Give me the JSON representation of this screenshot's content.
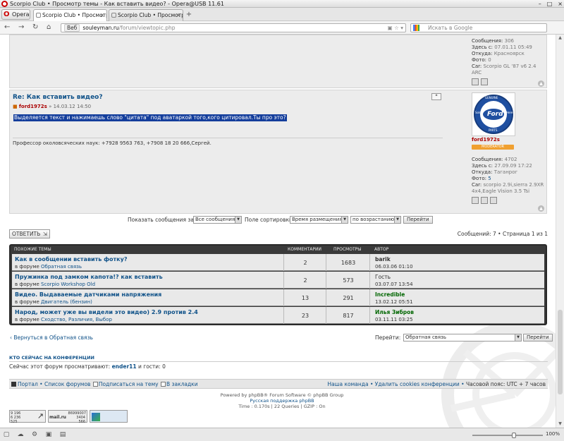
{
  "window": {
    "title": "Scorpio Club • Просмотр темы - Как вставить видео? - Opera@USB 11.61",
    "controls": [
      "–",
      "□",
      "×"
    ]
  },
  "browser": {
    "menu_label": "Opera",
    "tabs": [
      {
        "label": "Scorpio Club • Просмотр...",
        "active": true
      },
      {
        "label": "Scorpio Club • Просмотр...",
        "active": false
      }
    ],
    "badge": "Веб",
    "url_host": "souleyman.ru",
    "url_path": "/forum/viewtopic.php",
    "search_placeholder": "Искать в Google"
  },
  "prev_profile": {
    "messages_label": "Сообщения:",
    "messages": "306",
    "here_label": "Здесь с:",
    "here": "07.01.11 05:49",
    "from_label": "Откуда:",
    "from": "Красноярск",
    "photo_label": "Фото:",
    "photo": "0",
    "car_label": "Car:",
    "car": "Scorpio GL '87 v6 2.4 ARC"
  },
  "post": {
    "title": "Re: Как вставить видео?",
    "author": "ford1972s",
    "date": "» 14.03.12 14:50",
    "selected_text": "Выделяется текст и нажимаешь слово \"цитата\" под аватаркой того,кого цитировал.Ты про это?",
    "signature": "Профессор околовсяческих наук: +7928 9563 763, +7908 18 20 666,Сергей.",
    "quote_btn": "❝"
  },
  "profile": {
    "avatar_genuine": "GENUINE",
    "avatar_brand": "Ford",
    "avatar_parts": "PARTS",
    "avatar_left": "Sold",
    "avatar_right": "Here",
    "username": "ford1972s",
    "rank": "MODERATOR",
    "messages_label": "Сообщения:",
    "messages": "4702",
    "here_label": "Здесь с:",
    "here": "27.09.09 17:22",
    "from_label": "Откуда:",
    "from": "Таганрог",
    "photo_label": "Фото:",
    "photo": "5",
    "car_label": "Car:",
    "car": "scorpio 2.9i,sierra 2.9XR 4x4,Eagle Vision 3.5 Tsi"
  },
  "sortbar": {
    "show_label": "Показать сообщения за:",
    "show_value": "Все сообщения",
    "sort_label": "Поле сортировки",
    "sort_value": "Время размещения",
    "order_value": "по возрастанию",
    "go_label": "Перейти"
  },
  "reply_label": "ОТВЕТИТЬ",
  "page_info": "Сообщений: 7 • Страница 1 из 1",
  "similar": {
    "headers": {
      "topics": "ПОХОЖИЕ ТЕМЫ",
      "comments": "КОММЕНТАРИИ",
      "views": "ПРОСМОТРЫ",
      "author": "АВТОР"
    },
    "rows": [
      {
        "title": "Как в сообщении вставить фотку?",
        "forum_prefix": "в форуме",
        "forum": "Обратная связь",
        "comments": "2",
        "views": "1683",
        "author": "barik",
        "date": "06.03.06 01:10"
      },
      {
        "title": "Пружинка под замком капота!? как вставить",
        "forum_prefix": "в форуме",
        "forum": "Scorpio Workshop Old",
        "comments": "2",
        "views": "573",
        "author": "Гость",
        "date": "03.07.07 13:54"
      },
      {
        "title": "Видео. Выдаваемые датчиками напряжения",
        "forum_prefix": "в форуме",
        "forum": "Двигатель (бензин)",
        "comments": "13",
        "views": "291",
        "author": "Incredible",
        "date": "13.02.12 05:51"
      },
      {
        "title": "Народ, может уже вы видели это видео) 2.9 против 2.4",
        "forum_prefix": "в форуме",
        "forum": "Сходство, Различия, Выбор",
        "comments": "23",
        "views": "817",
        "author": "Илья Зибров",
        "date": "03.11.11 03:25"
      }
    ]
  },
  "back_link": "‹ Вернуться в Обратная связь",
  "jump": {
    "label": "Перейти:",
    "value": "Обратная связь",
    "go": "Перейти"
  },
  "online": {
    "heading": "КТО СЕЙЧАС НА КОНФЕРЕНЦИИ",
    "text_prefix": "Сейчас этот форум просматривают:",
    "user": "ender11",
    "text_suffix": "и гости: 0"
  },
  "footer_nav": {
    "portal": "Портал",
    "sep": "•",
    "forums": "Список форумов",
    "subscribe": "Подписаться на тему",
    "bookmarks": "В закладки",
    "team": "Наша команда",
    "delete_cookies": "Удалить cookies конференции",
    "timezone": "Часовой пояс: UTC + 7 часов"
  },
  "powered": {
    "line1": "Powered by phpBB® Forum Software © phpBB Group",
    "line2": "Русская поддержка phpBB",
    "line3": "Time : 0.170s | 22 Queries | GZIP : On"
  },
  "counters": {
    "c1": [
      "9 196",
      "6 236",
      "525"
    ],
    "c2_top": "86999007",
    "c2_nums": [
      "3404",
      "566"
    ],
    "c2_brand": "mail.ru"
  },
  "statusbar": {
    "zoom": "100%"
  }
}
